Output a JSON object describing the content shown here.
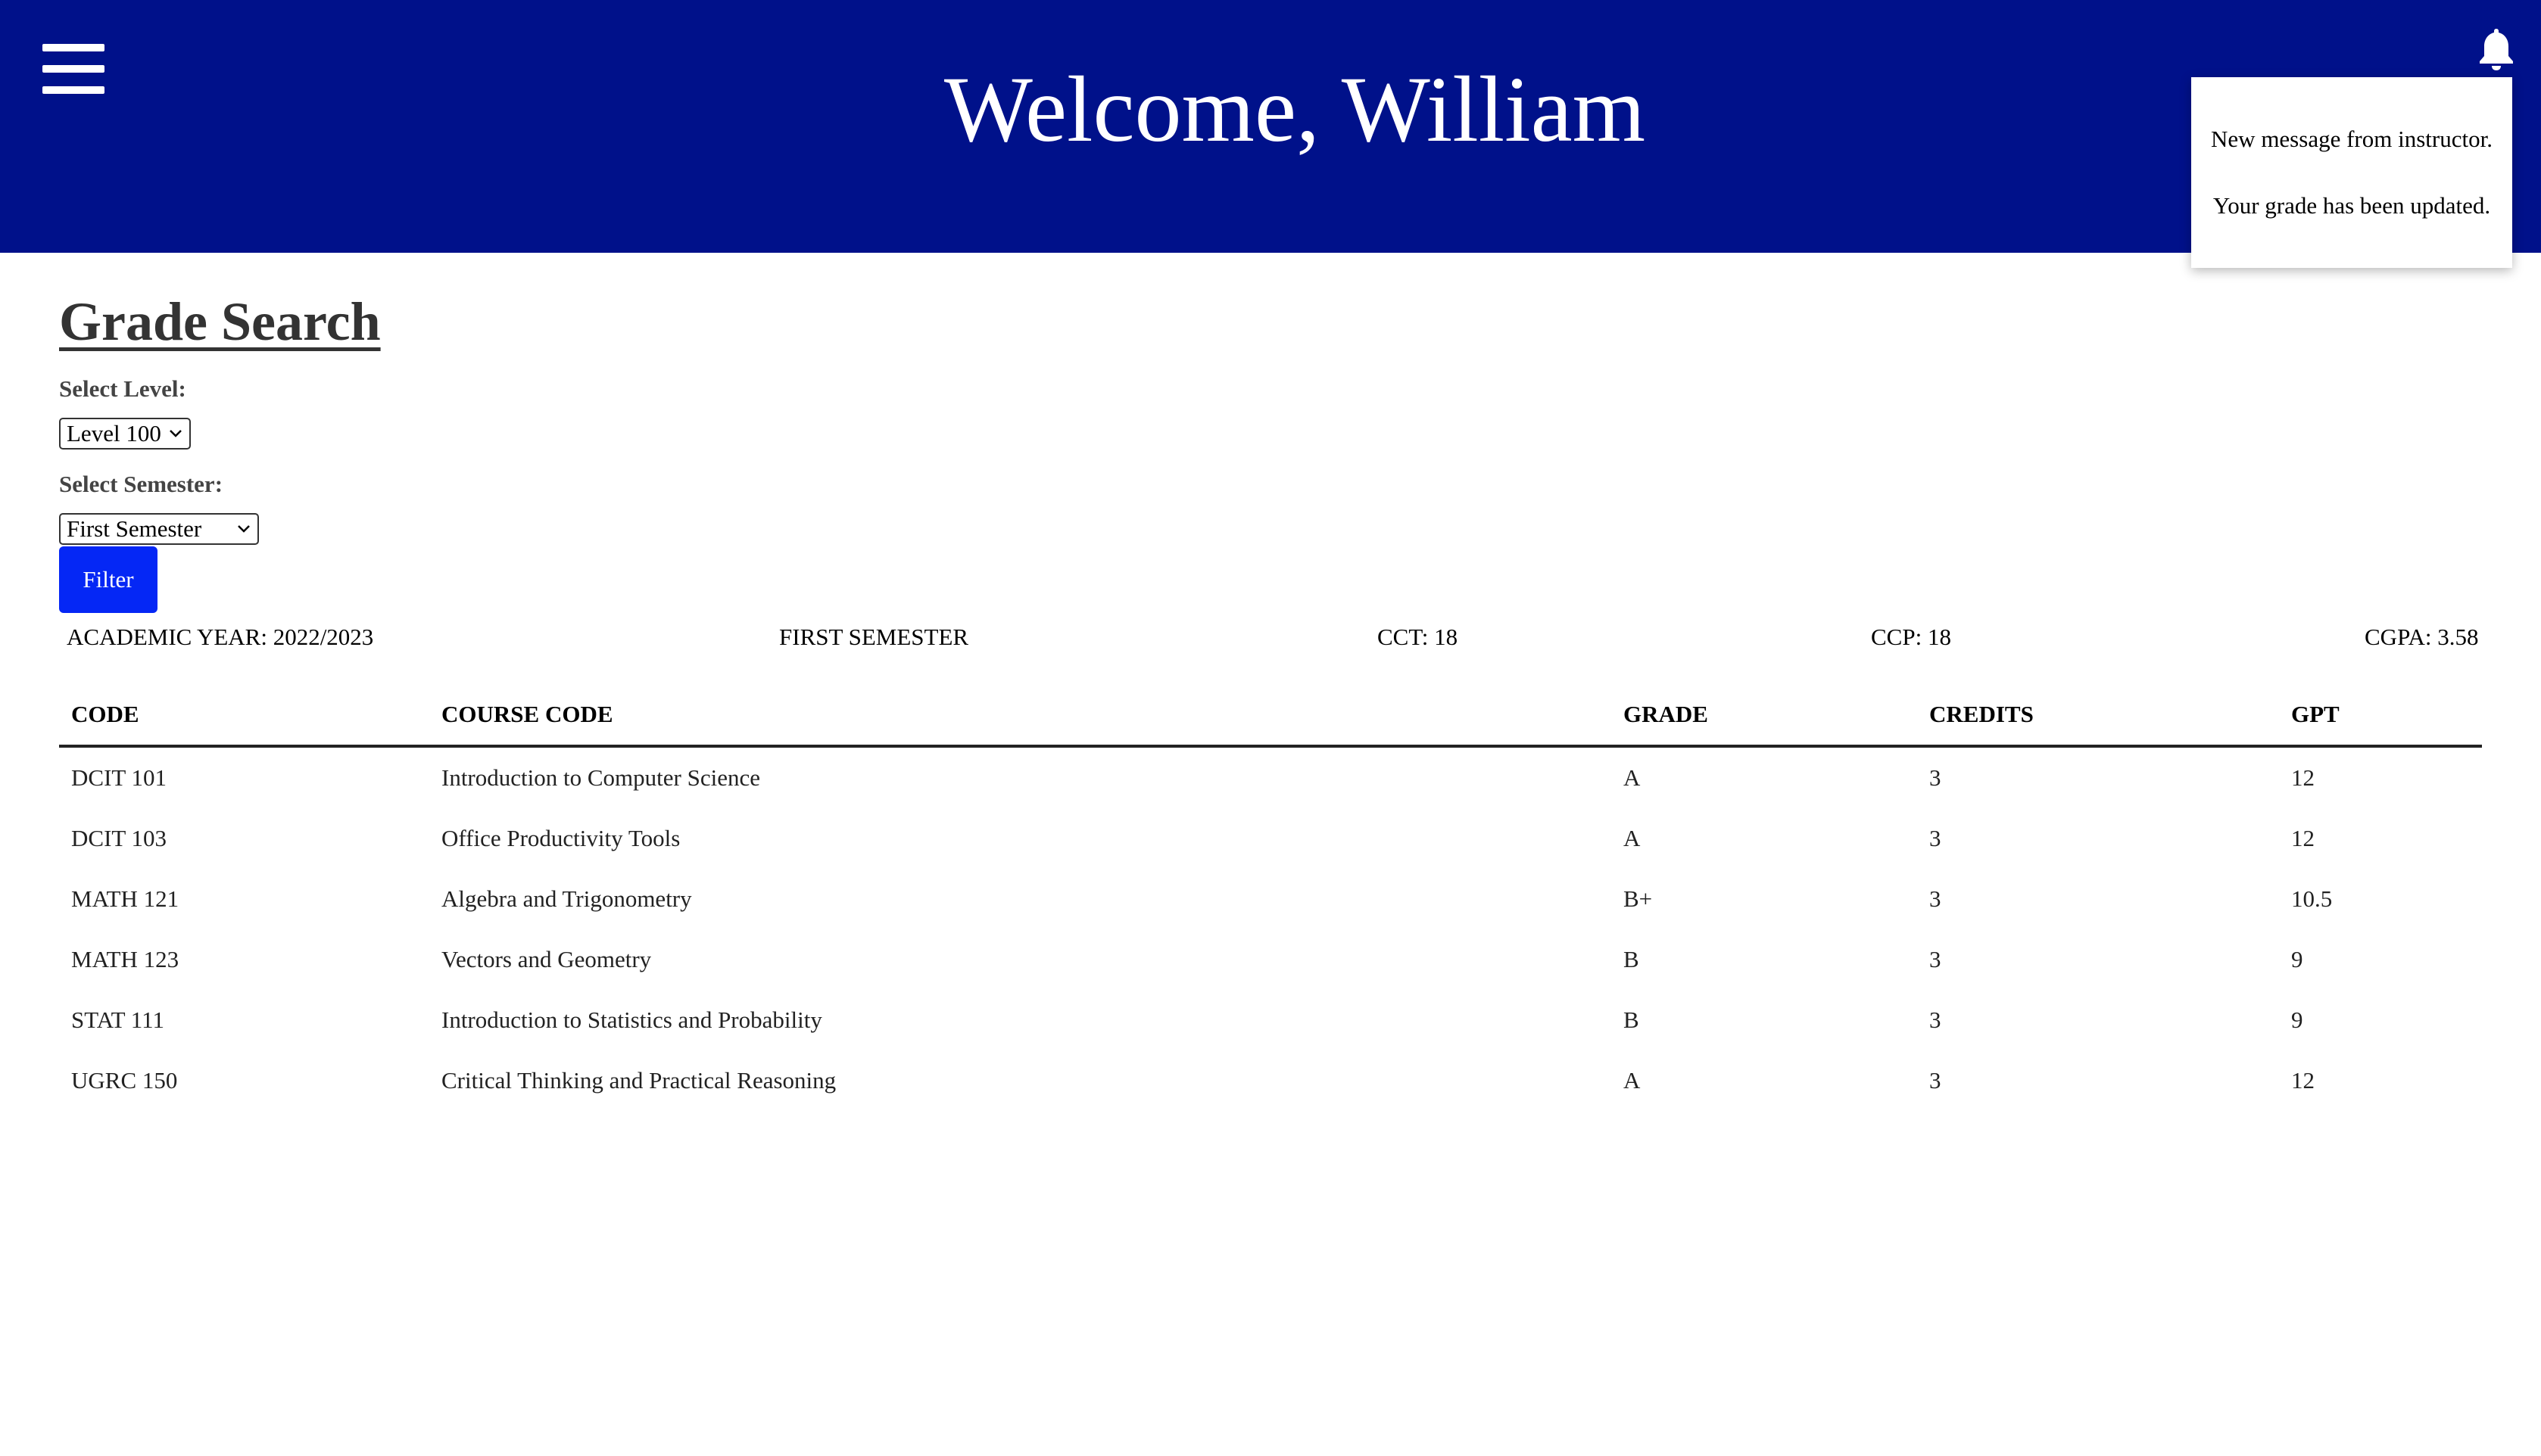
{
  "header": {
    "welcome": "Welcome, William",
    "menu_icon": "hamburger-menu-icon",
    "bell_icon": "bell-icon",
    "background_color": "#00118a"
  },
  "notifications": [
    "New message from instructor.",
    "Your grade has been updated."
  ],
  "grade_search": {
    "title": "Grade Search",
    "level_label": "Select Level:",
    "level_value": "Level 100",
    "semester_label": "Select Semester:",
    "semester_value": "First Semester",
    "filter_label": "Filter",
    "filter_color": "#0527f5"
  },
  "summary": {
    "academic_year": "ACADEMIC YEAR: 2022/2023",
    "semester": "FIRST SEMESTER",
    "cct": "CCT: 18",
    "ccp": "CCP: 18",
    "cgpa": "CGPA: 3.58"
  },
  "table": {
    "headers": [
      "CODE",
      "COURSE CODE",
      "GRADE",
      "CREDITS",
      "GPT"
    ],
    "rows": [
      [
        "DCIT 101",
        "Introduction to Computer Science",
        "A",
        "3",
        "12"
      ],
      [
        "DCIT 103",
        "Office Productivity Tools",
        "A",
        "3",
        "12"
      ],
      [
        "MATH 121",
        "Algebra and Trigonometry",
        "B+",
        "3",
        "10.5"
      ],
      [
        "MATH 123",
        "Vectors and Geometry",
        "B",
        "3",
        "9"
      ],
      [
        "STAT 111",
        "Introduction to Statistics and Probability",
        "B",
        "3",
        "9"
      ],
      [
        "UGRC 150",
        "Critical Thinking and Practical Reasoning",
        "A",
        "3",
        "12"
      ]
    ]
  }
}
